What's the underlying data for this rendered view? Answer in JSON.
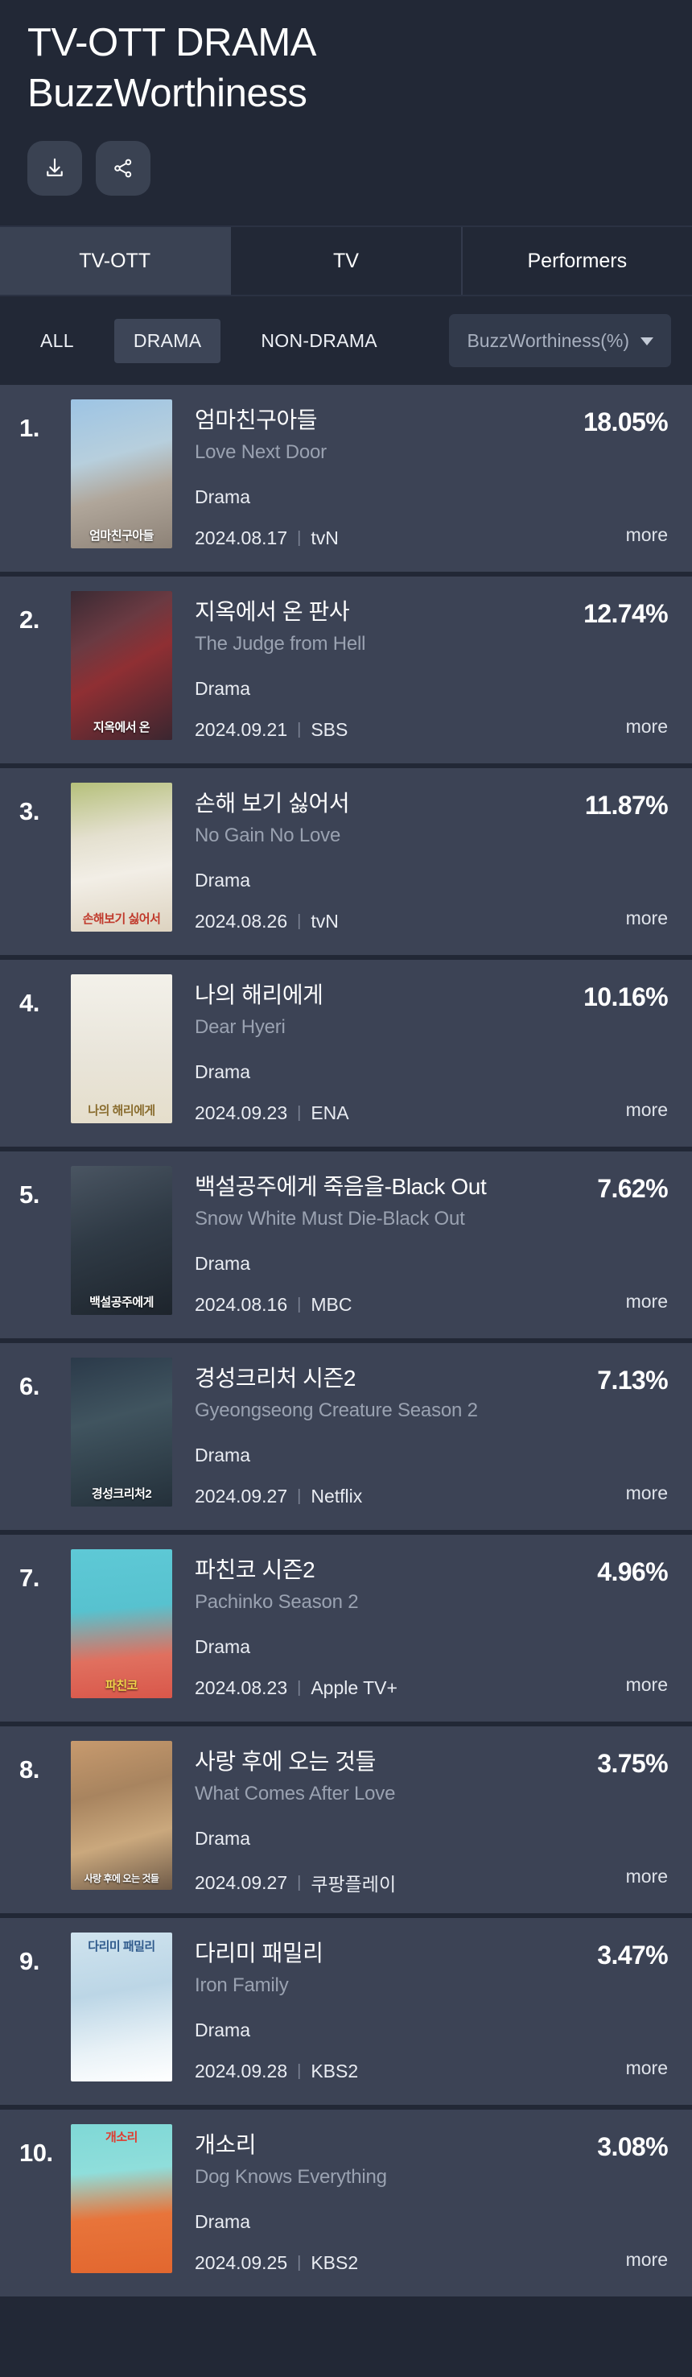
{
  "header": {
    "title": "TV-OTT DRAMA\nBuzzWorthiness",
    "download_label": "download-icon",
    "share_label": "share-icon"
  },
  "tabs": [
    {
      "label": "TV-OTT",
      "active": true
    },
    {
      "label": "TV",
      "active": false
    },
    {
      "label": "Performers",
      "active": false
    }
  ],
  "filters": {
    "chips": [
      {
        "label": "ALL",
        "active": false
      },
      {
        "label": "DRAMA",
        "active": true
      },
      {
        "label": "NON-DRAMA",
        "active": false
      }
    ],
    "sort": {
      "label": "BuzzWorthiness(%)"
    }
  },
  "colors": {
    "page_bg": "#222836",
    "row_bg": "#3c4355",
    "tab_active_bg": "#3a4253",
    "chip_active_bg": "#3d4557",
    "text_primary": "#ffffff",
    "text_secondary": "#9aa2b1"
  },
  "list": {
    "more_label": "more",
    "items": [
      {
        "rank": "1.",
        "title_kr": "엄마친구아들",
        "title_en": "Love Next Door",
        "genre": "Drama",
        "date": "2024.08.17",
        "channel": "tvN",
        "score": "18.05%",
        "poster_caption": "엄마친구아들"
      },
      {
        "rank": "2.",
        "title_kr": "지옥에서 온 판사",
        "title_en": "The Judge from Hell",
        "genre": "Drama",
        "date": "2024.09.21",
        "channel": "SBS",
        "score": "12.74%",
        "poster_caption": "지옥에서 온"
      },
      {
        "rank": "3.",
        "title_kr": "손해 보기 싫어서",
        "title_en": "No Gain No Love",
        "genre": "Drama",
        "date": "2024.08.26",
        "channel": "tvN",
        "score": "11.87%",
        "poster_caption": "손해보기 싫어서"
      },
      {
        "rank": "4.",
        "title_kr": "나의 해리에게",
        "title_en": "Dear Hyeri",
        "genre": "Drama",
        "date": "2024.09.23",
        "channel": "ENA",
        "score": "10.16%",
        "poster_caption": "나의 해리에게"
      },
      {
        "rank": "5.",
        "title_kr": "백설공주에게 죽음을-Black Out",
        "title_en": "Snow White Must Die-Black Out",
        "genre": "Drama",
        "date": "2024.08.16",
        "channel": "MBC",
        "score": "7.62%",
        "poster_caption": "백설공주에게"
      },
      {
        "rank": "6.",
        "title_kr": "경성크리처 시즌2",
        "title_en": "Gyeongseong Creature Season 2",
        "genre": "Drama",
        "date": "2024.09.27",
        "channel": "Netflix",
        "score": "7.13%",
        "poster_caption": "경성크리처2"
      },
      {
        "rank": "7.",
        "title_kr": "파친코 시즌2",
        "title_en": "Pachinko Season 2",
        "genre": "Drama",
        "date": "2024.08.23",
        "channel": "Apple TV+",
        "score": "4.96%",
        "poster_caption": "파친코"
      },
      {
        "rank": "8.",
        "title_kr": "사랑 후에 오는 것들",
        "title_en": "What Comes After Love",
        "genre": "Drama",
        "date": "2024.09.27",
        "channel": "쿠팡플레이",
        "score": "3.75%",
        "poster_caption": "사랑 후에 오는 것들"
      },
      {
        "rank": "9.",
        "title_kr": "다리미 패밀리",
        "title_en": "Iron Family",
        "genre": "Drama",
        "date": "2024.09.28",
        "channel": "KBS2",
        "score": "3.47%",
        "poster_caption": "다리미 패밀리"
      },
      {
        "rank": "10.",
        "title_kr": "개소리",
        "title_en": "Dog Knows Everything",
        "genre": "Drama",
        "date": "2024.09.25",
        "channel": "KBS2",
        "score": "3.08%",
        "poster_caption": "개소리"
      }
    ]
  }
}
